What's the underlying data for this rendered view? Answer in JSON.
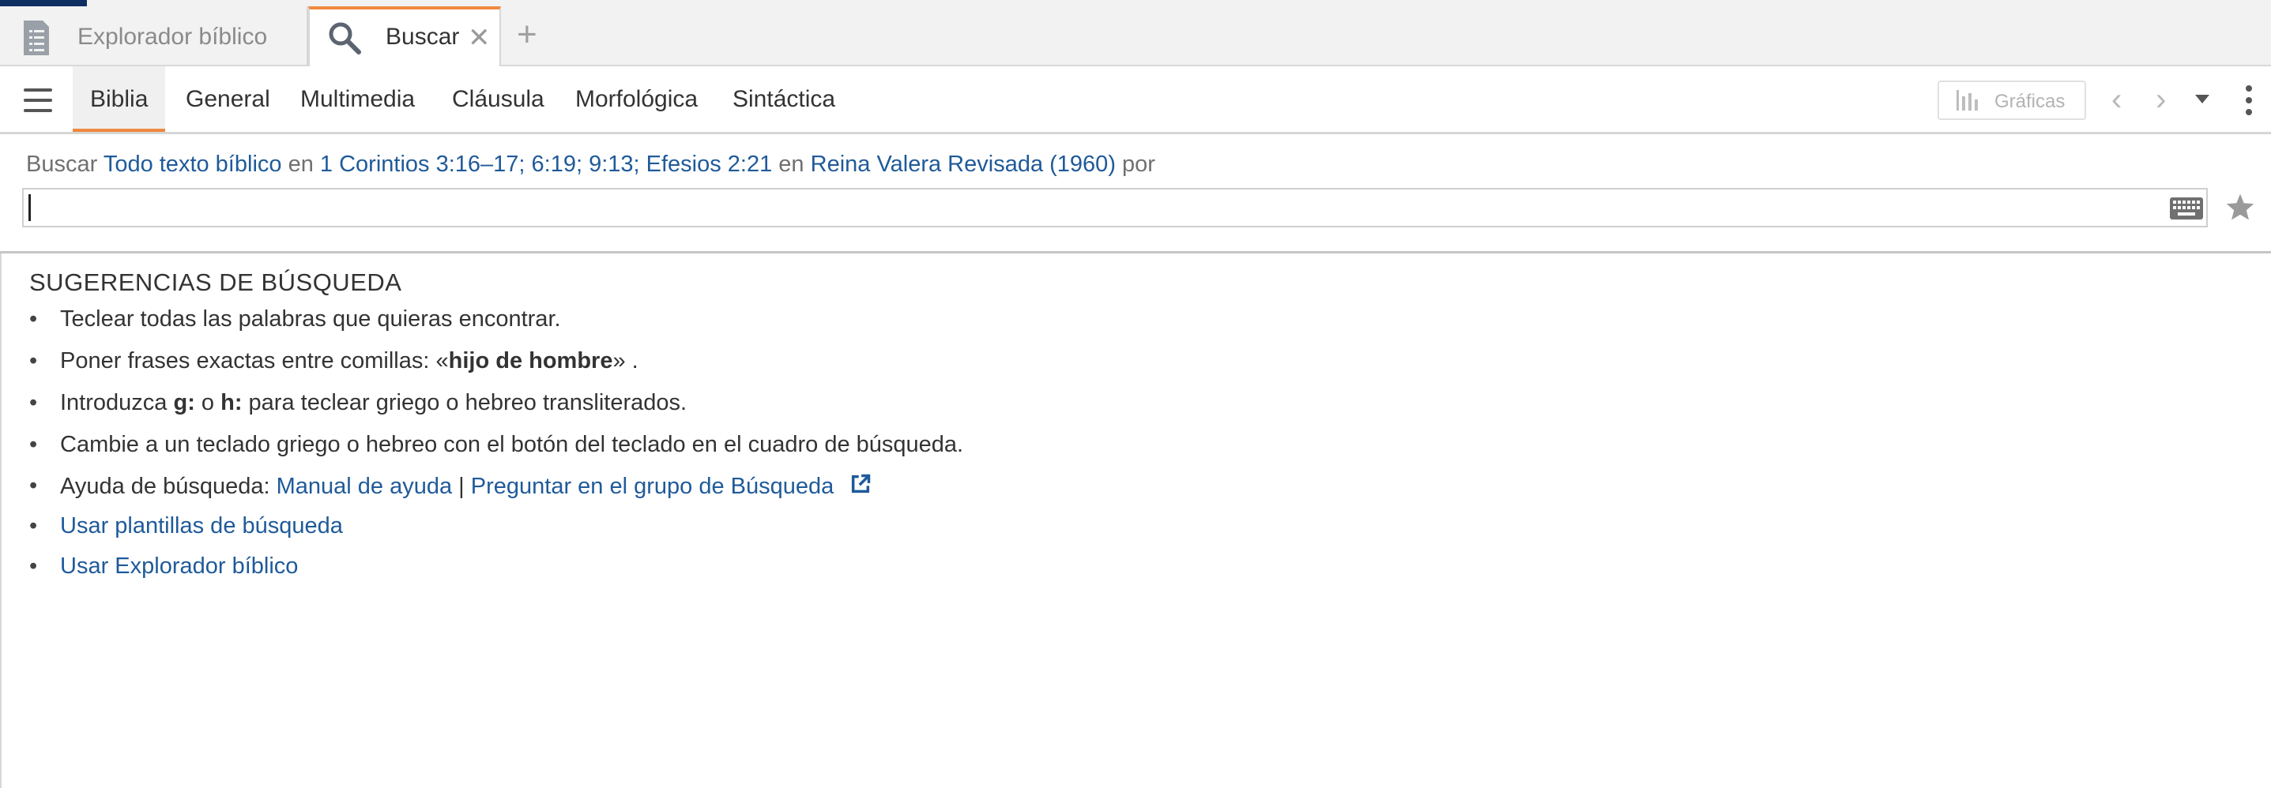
{
  "tabs": {
    "explorer_label": "Explorador bíblico",
    "search_label": "Buscar",
    "close_label": "✕",
    "add_label": "+"
  },
  "toolbar": {
    "subtabs": [
      "Biblia",
      "General",
      "Multimedia",
      "Cláusula",
      "Morfológica",
      "Sintáctica"
    ],
    "active_subtab": "Biblia",
    "graficas_label": "Gráficas",
    "prev_label": "‹",
    "next_label": "›"
  },
  "search": {
    "prefix": "Buscar",
    "scope": "Todo texto bíblico",
    "in1": "en",
    "references": "1 Corintios 3:16–17; 6:19; 9:13; Efesios 2:21",
    "in2": "en",
    "version": "Reina Valera Revisada (1960)",
    "by": "por",
    "query": "",
    "placeholder": ""
  },
  "tips": {
    "heading": "SUGERENCIAS DE BÚSQUEDA",
    "bullet": "•",
    "items": {
      "t1": "Teclear todas las palabras que quieras encontrar.",
      "t2_before": "Poner frases exactas entre comillas:  «",
      "t2_bold": "hijo de hombre",
      "t2_after": "» .",
      "t3_a": "Introduzca ",
      "t3_g": "g:",
      "t3_b": " o ",
      "t3_h": "h:",
      "t3_c": " para teclear griego o hebreo transliterados.",
      "t4": "Cambie a un teclado griego o hebreo con el botón del teclado en el cuadro de búsqueda.",
      "t5_prefix": "Ayuda de búsqueda: ",
      "t5_link1": "Manual de ayuda",
      "t5_sep": " | ",
      "t5_link2": "Preguntar en el grupo de Búsqueda",
      "t6": "Usar plantillas de búsqueda",
      "t7": "Usar Explorador bíblico"
    }
  },
  "colors": {
    "accent_orange": "#f0893e",
    "link_blue": "#1f5a9a",
    "corner_navy": "#0f2f63"
  },
  "icons": [
    "document-list-icon",
    "search-icon",
    "close-icon",
    "add-tab-icon",
    "hamburger-menu-icon",
    "bar-chart-icon",
    "chevron-left-icon",
    "chevron-right-icon",
    "caret-down-icon",
    "kebab-menu-icon",
    "keyboard-icon",
    "star-icon",
    "external-link-icon"
  ]
}
